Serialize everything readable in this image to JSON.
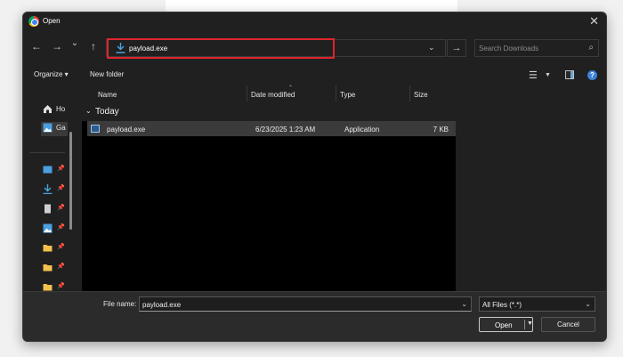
{
  "window": {
    "title": "Open"
  },
  "nav": {
    "back_glyph": "←",
    "forward_glyph": "→",
    "recent_glyph": "⌄",
    "up_glyph": "↑",
    "address_path": "payload.exe",
    "address_icon": "download-icon",
    "go_glyph": "→",
    "search_placeholder": "Search Downloads"
  },
  "toolbar": {
    "organize_label": "Organize ▾",
    "new_folder_label": "New folder",
    "help_glyph": "?"
  },
  "sidebar": {
    "items": [
      {
        "label": "Ho",
        "icon": "home-icon",
        "color": "#e0e0e0"
      },
      {
        "label": "Ga",
        "icon": "gallery-icon",
        "color": "#4a9fe0"
      }
    ],
    "pinned": [
      {
        "icon": "desktop-icon",
        "color": "#4a9fe0"
      },
      {
        "icon": "download-icon",
        "color": "#4aa3df"
      },
      {
        "icon": "documents-icon",
        "color": "#cfcfcf"
      },
      {
        "icon": "pictures-icon",
        "color": "#4a9fe0"
      },
      {
        "icon": "folder-icon",
        "color": "#f2c14e"
      },
      {
        "icon": "folder-icon",
        "color": "#f2c14e"
      },
      {
        "icon": "folder-icon",
        "color": "#f2c14e"
      }
    ]
  },
  "columns": {
    "name": "Name",
    "date": "Date modified",
    "type": "Type",
    "size": "Size"
  },
  "group": {
    "label": "Today"
  },
  "files": [
    {
      "name": "payload.exe",
      "date": "6/23/2025 1:23 AM",
      "type": "Application",
      "size": "7 KB"
    }
  ],
  "footer": {
    "file_name_label": "File name:",
    "file_name_value": "payload.exe",
    "file_type": "All Files (*.*)",
    "open_label": "Open",
    "cancel_label": "Cancel"
  },
  "colors": {
    "highlight_box": "#e0242c",
    "accent": "#3b82d6"
  }
}
